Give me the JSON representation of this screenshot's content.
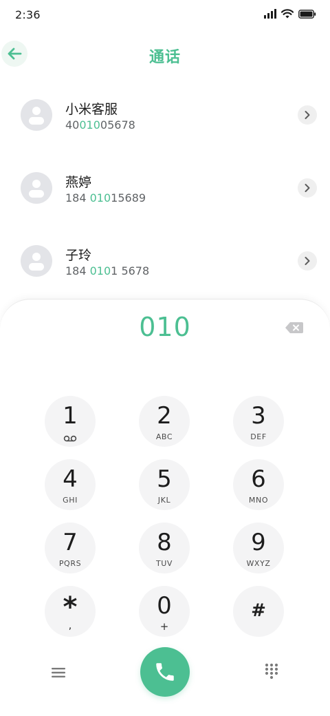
{
  "status_bar": {
    "time": "2:36",
    "icons": [
      "signal-icon",
      "wifi-icon",
      "battery-icon"
    ]
  },
  "header": {
    "title": "通话",
    "back_icon": "arrow-left-icon"
  },
  "contacts": [
    {
      "name": "小米客服",
      "number_pre": "40",
      "number_match": "010",
      "number_post": "05678"
    },
    {
      "name": "燕婷",
      "number_pre": "184 ",
      "number_match": "010",
      "number_post": "15689"
    },
    {
      "name": "子玲",
      "number_pre": "184 ",
      "number_match": "010",
      "number_post": "1 5678"
    }
  ],
  "dialer": {
    "input_value": "010",
    "keys": [
      {
        "digit": "1",
        "letters": ""
      },
      {
        "digit": "2",
        "letters": "ABC"
      },
      {
        "digit": "3",
        "letters": "DEF"
      },
      {
        "digit": "4",
        "letters": "GHI"
      },
      {
        "digit": "5",
        "letters": "JKL"
      },
      {
        "digit": "6",
        "letters": "MNO"
      },
      {
        "digit": "7",
        "letters": "PQRS"
      },
      {
        "digit": "8",
        "letters": "TUV"
      },
      {
        "digit": "9",
        "letters": "WXYZ"
      },
      {
        "digit": "*",
        "letters": ","
      },
      {
        "digit": "0",
        "letters": "+"
      },
      {
        "digit": "#",
        "letters": ""
      }
    ]
  },
  "colors": {
    "accent": "#4cbf92",
    "key_background": "#f4f4f5",
    "avatar_background": "#e3e4e8"
  }
}
